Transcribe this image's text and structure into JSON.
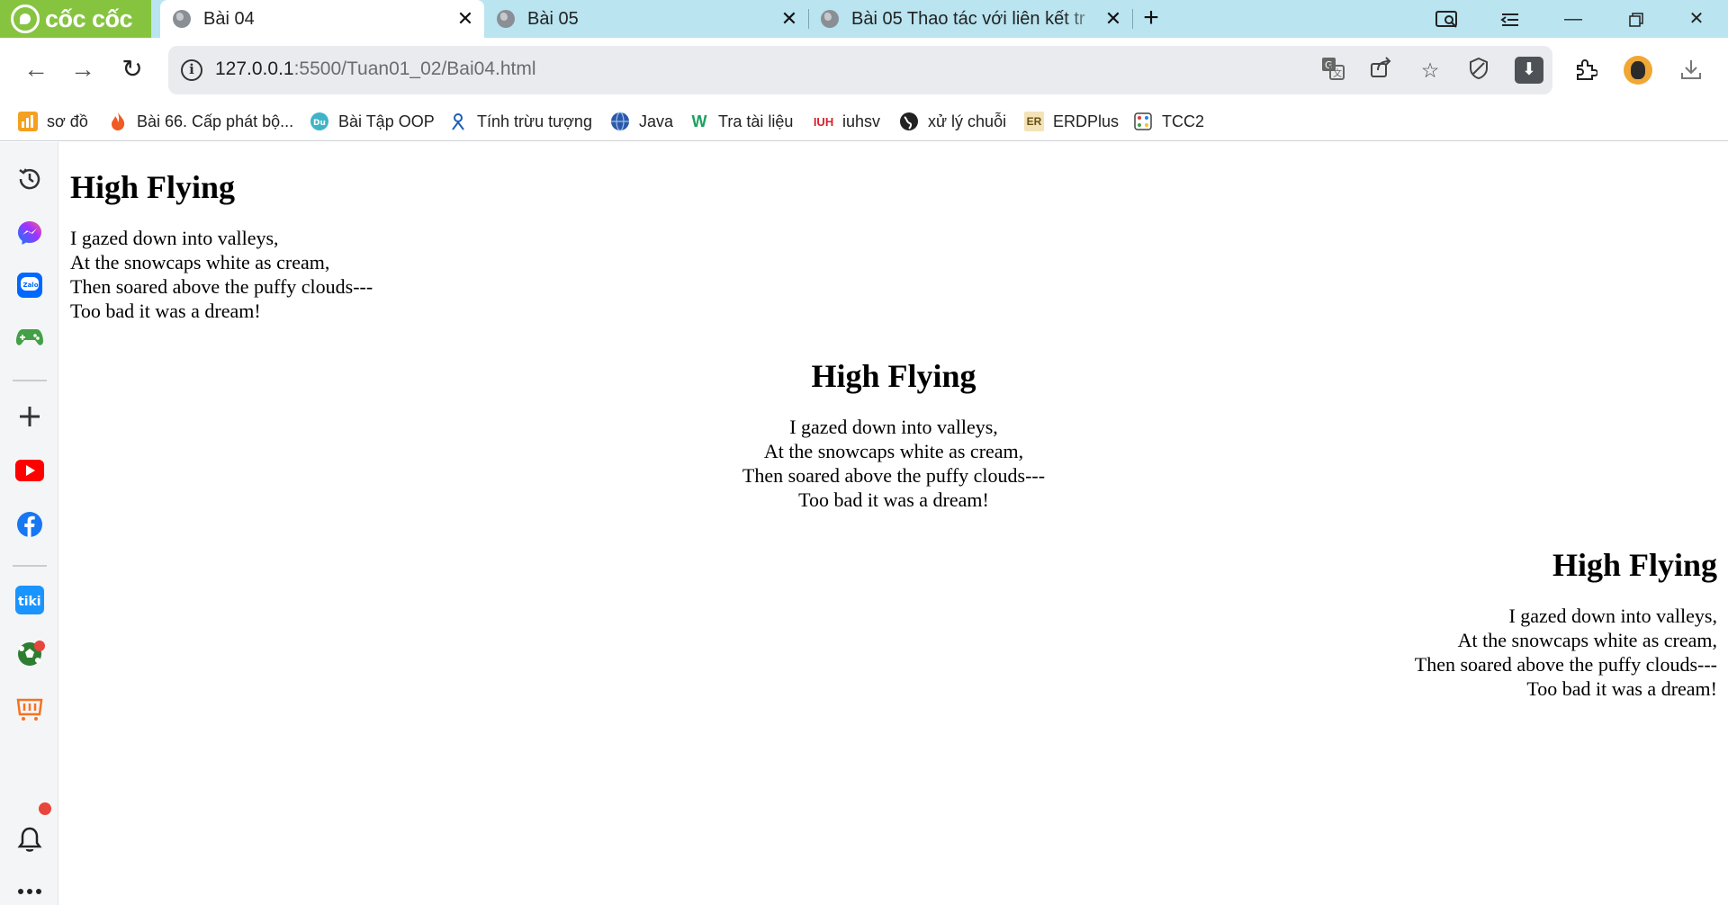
{
  "browser": {
    "brand": "cốc cốc",
    "tabs": [
      {
        "title": "Bài 04",
        "active": true
      },
      {
        "title": "Bài 05",
        "active": false
      },
      {
        "title": "Bài 05 Thao tác với liên kết tr",
        "active": false
      }
    ],
    "url": {
      "host": "127.0.0.1",
      "path": ":5500/Tuan01_02/Bai04.html"
    },
    "bookmarks": [
      {
        "label": "sơ đồ",
        "icon": "bar-chart-icon",
        "color": "#f4a020"
      },
      {
        "label": "Bài 66. Cấp phát bộ...",
        "icon": "fire-icon",
        "color": "#f05a24"
      },
      {
        "label": "Bài Tập OOP",
        "icon": "duck-icon",
        "color": "#3fb4c8"
      },
      {
        "label": "Tính trừu tượng",
        "icon": "person-pin-icon",
        "color": "#1a5fb4"
      },
      {
        "label": "Java",
        "icon": "globe-icon",
        "color": "#2c58a8"
      },
      {
        "label": "Tra tài liệu",
        "icon": "w-logo-icon",
        "color": "#1aa260"
      },
      {
        "label": "iuhsv",
        "icon": "iuh-logo-icon",
        "color": "#d3232f"
      },
      {
        "label": "xử lý chuỗi",
        "icon": "globe-dark-icon",
        "color": "#222222"
      },
      {
        "label": "ERDPlus",
        "icon": "er-logo-icon",
        "color": "#c99b2a"
      },
      {
        "label": "TCC2",
        "icon": "abacus-icon",
        "color": "#e53935"
      }
    ]
  },
  "sidebar": [
    "history-icon",
    "messenger-icon",
    "zalo-icon",
    "gamepad-icon",
    "add-icon",
    "youtube-icon",
    "facebook-icon",
    "tiki-icon",
    "football-icon",
    "shopping-icon",
    "notification-icon",
    "more-icon"
  ],
  "page": {
    "poems": [
      {
        "align": "left",
        "title": "High Flying",
        "lines": [
          "I gazed down into valleys,",
          "At the snowcaps white as cream,",
          "Then soared above the puffy clouds---",
          "Too bad it was a dream!"
        ]
      },
      {
        "align": "center",
        "title": "High Flying",
        "lines": [
          "I gazed down into valleys,",
          "At the snowcaps white as cream,",
          "Then soared above the puffy clouds---",
          "Too bad it was a dream!"
        ]
      },
      {
        "align": "right",
        "title": "High Flying",
        "lines": [
          "I gazed down into valleys,",
          "At the snowcaps white as cream,",
          "Then soared above the puffy clouds---",
          "Too bad it was a dream!"
        ]
      }
    ]
  }
}
